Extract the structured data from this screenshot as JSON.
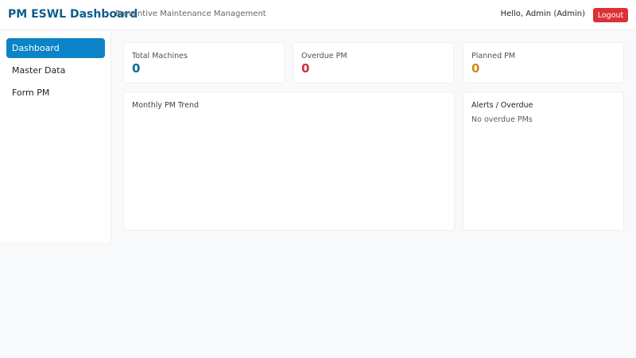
{
  "header": {
    "title": "PM ESWL Dashboard",
    "subtitle": "Preventive Maintenance Management",
    "greeting": "Hello, Admin (Admin)",
    "logout_label": "Logout"
  },
  "sidebar": {
    "items": [
      {
        "label": "Dashboard",
        "active": true
      },
      {
        "label": "Master Data",
        "active": false
      },
      {
        "label": "Form PM",
        "active": false
      }
    ]
  },
  "stats": [
    {
      "label": "Total Machines",
      "value": "0",
      "color": "#0d6b94"
    },
    {
      "label": "Overdue PM",
      "value": "0",
      "color": "#c8323a"
    },
    {
      "label": "Planned PM",
      "value": "0",
      "color": "#d08a12"
    }
  ],
  "trend": {
    "title": "Monthly PM Trend"
  },
  "alerts": {
    "title": "Alerts / Overdue",
    "empty_text": "No overdue PMs"
  },
  "colors": {
    "accent": "#0a84c6",
    "danger": "#dc3136",
    "brand": "#0d5e8e"
  }
}
